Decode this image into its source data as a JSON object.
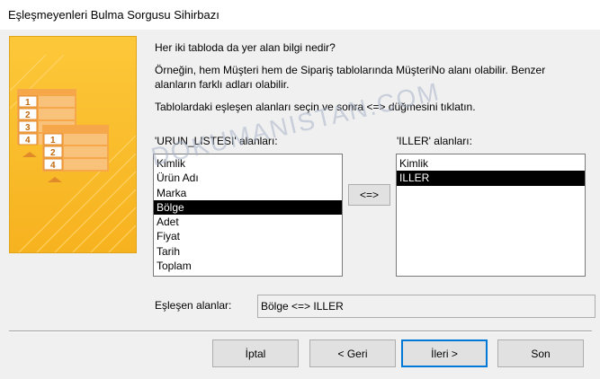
{
  "window": {
    "title": "Eşleşmeyenleri Bulma Sorgusu Sihirbazı"
  },
  "art": {
    "row_numbers_back": [
      "1",
      "2",
      "3",
      "4"
    ],
    "row_numbers_front": [
      "1",
      "2",
      "4"
    ]
  },
  "instructions": {
    "question": "Her iki tabloda da yer alan bilgi nedir?",
    "example_line1": "Örneğin, hem Müşteri hem de Sipariş tablolarında MüşteriNo alanı olabilir. Benzer",
    "example_line2": "alanların farklı adları olabilir.",
    "action": "Tablolardaki eşleşen alanları seçin ve sonra <=> düğmesini tıklatın."
  },
  "left_list": {
    "label": "'URUN_LISTESI' alanları:",
    "items": [
      "Kimlik",
      "Ürün Adı",
      "Marka",
      "Bölge",
      "Adet",
      "Fiyat",
      "Tarih",
      "Toplam"
    ],
    "selected": "Bölge"
  },
  "right_list": {
    "label": "'ILLER' alanları:",
    "items": [
      "Kimlik",
      "ILLER"
    ],
    "selected": "ILLER"
  },
  "match_button": {
    "label": "<=>"
  },
  "matched": {
    "label": "Eşleşen alanlar:",
    "value": "Bölge <=> ILLER"
  },
  "footer": {
    "cancel": "İptal",
    "back": "< Geri",
    "next": "İleri >",
    "finish": "Son"
  },
  "watermark": {
    "text": "DOKUMANISTAN.COM"
  },
  "colors": {
    "art_yellow": "#f9bd2a",
    "art_orange": "#ef9a2e",
    "selection": "#000000",
    "default_button_border": "#0078d7"
  }
}
